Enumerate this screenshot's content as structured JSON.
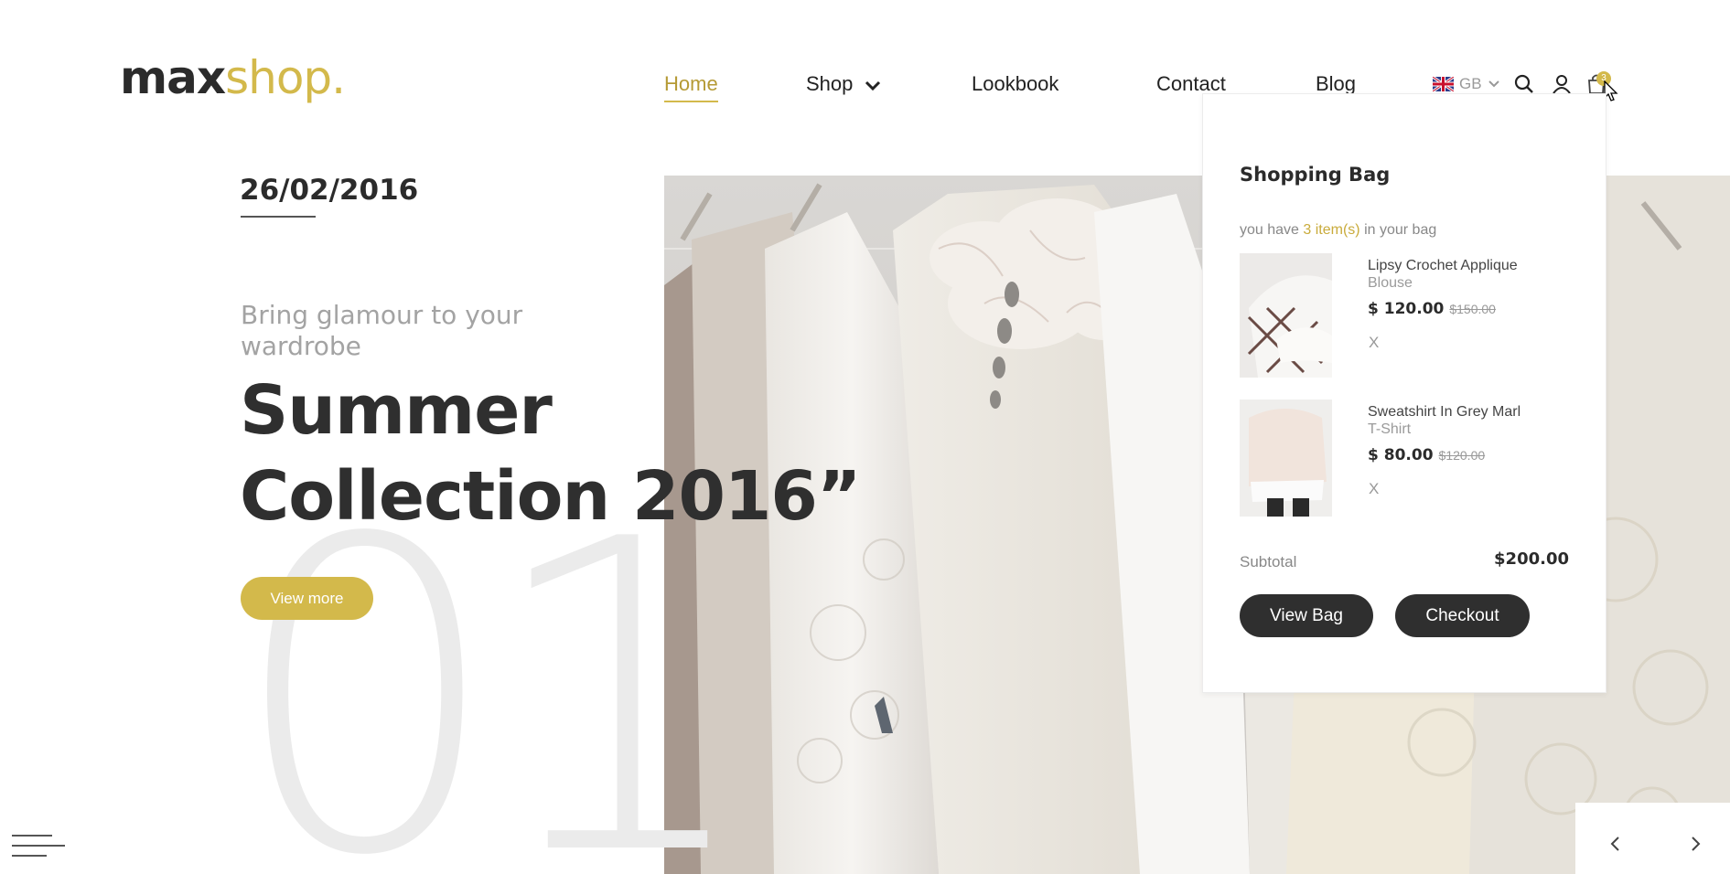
{
  "brand": {
    "logo_part1": "max",
    "logo_part2": "shop.",
    "accent_color": "#d3b94b"
  },
  "nav": {
    "items": [
      {
        "label": "Home",
        "active": true
      },
      {
        "label": "Shop"
      },
      {
        "label": "Lookbook"
      },
      {
        "label": "Contact"
      },
      {
        "label": "Blog"
      }
    ]
  },
  "header_tools": {
    "language": "GB",
    "icons": [
      "uk-flag-icon",
      "chevron-down-icon",
      "search-icon",
      "user-icon",
      "shopping-bag-icon"
    ],
    "bag_badge": "3"
  },
  "hero": {
    "date": "26/02/2016",
    "subtitle": "Bring glamour to your wardrobe",
    "headline_line1": "Summer",
    "headline_line2": "Collection 2016”",
    "slide_number": "01",
    "button_label": "View more"
  },
  "bag": {
    "title": "Shopping Bag",
    "count_prefix": "you have ",
    "count_highlight": "3 item(s)",
    "count_suffix": " in your bag",
    "items": [
      {
        "name": "Lipsy Crochet Applique",
        "type": "Blouse",
        "price": "$ 120.00",
        "old_price": "$150.00",
        "remove": "X"
      },
      {
        "name": "Sweatshirt In Grey Marl",
        "type": "T-Shirt",
        "price": "$ 80.00",
        "old_price": "$120.00",
        "remove": "X"
      }
    ],
    "subtotal_label": "Subtotal",
    "subtotal_value": "$200.00",
    "view_bag_label": "View Bag",
    "checkout_label": "Checkout"
  }
}
